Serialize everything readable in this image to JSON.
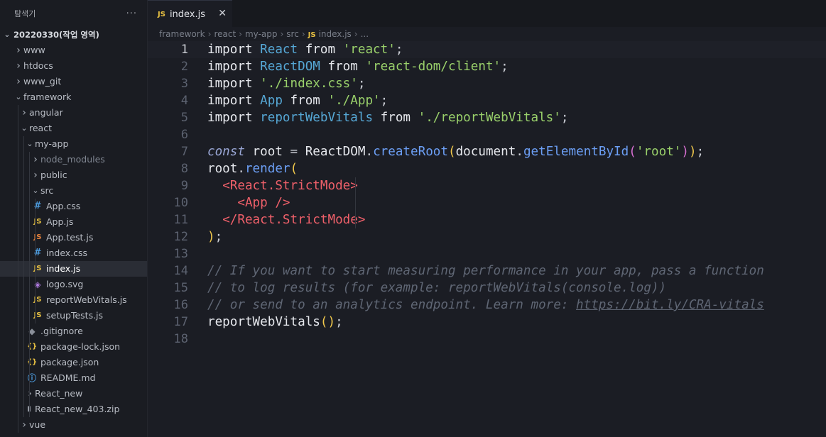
{
  "explorer": {
    "title": "탐색기",
    "more_icon": "more-icon",
    "items": [
      {
        "label": "20220330(작업 영역)",
        "depth": 0,
        "chevron": "down",
        "icon": "",
        "root": true
      },
      {
        "label": "www",
        "depth": 1,
        "chevron": "right",
        "icon": ""
      },
      {
        "label": "htdocs",
        "depth": 1,
        "chevron": "right",
        "icon": ""
      },
      {
        "label": "www_git",
        "depth": 1,
        "chevron": "right",
        "icon": ""
      },
      {
        "label": "framework",
        "depth": 1,
        "chevron": "down",
        "icon": ""
      },
      {
        "label": "angular",
        "depth": 2,
        "chevron": "right",
        "icon": ""
      },
      {
        "label": "react",
        "depth": 2,
        "chevron": "down",
        "icon": ""
      },
      {
        "label": "my-app",
        "depth": 3,
        "chevron": "down",
        "icon": ""
      },
      {
        "label": "node_modules",
        "depth": 4,
        "chevron": "right",
        "icon": "",
        "dim": true
      },
      {
        "label": "public",
        "depth": 4,
        "chevron": "right",
        "icon": ""
      },
      {
        "label": "src",
        "depth": 4,
        "chevron": "down",
        "icon": ""
      },
      {
        "label": "App.css",
        "depth": 5,
        "chevron": "",
        "icon": "css"
      },
      {
        "label": "App.js",
        "depth": 5,
        "chevron": "",
        "icon": "js"
      },
      {
        "label": "App.test.js",
        "depth": 5,
        "chevron": "",
        "icon": "test"
      },
      {
        "label": "index.css",
        "depth": 5,
        "chevron": "",
        "icon": "css"
      },
      {
        "label": "index.js",
        "depth": 5,
        "chevron": "",
        "icon": "js",
        "selected": true
      },
      {
        "label": "logo.svg",
        "depth": 5,
        "chevron": "",
        "icon": "svg"
      },
      {
        "label": "reportWebVitals.js",
        "depth": 5,
        "chevron": "",
        "icon": "js"
      },
      {
        "label": "setupTests.js",
        "depth": 5,
        "chevron": "",
        "icon": "js"
      },
      {
        "label": ".gitignore",
        "depth": 4,
        "chevron": "",
        "icon": "git"
      },
      {
        "label": "package-lock.json",
        "depth": 4,
        "chevron": "",
        "icon": "json"
      },
      {
        "label": "package.json",
        "depth": 4,
        "chevron": "",
        "icon": "json"
      },
      {
        "label": "README.md",
        "depth": 4,
        "chevron": "",
        "icon": "info"
      },
      {
        "label": "React_new",
        "depth": 3,
        "chevron": "right",
        "icon": ""
      },
      {
        "label": "React_new_403.zip",
        "depth": 3,
        "chevron": "",
        "icon": "zip"
      },
      {
        "label": "vue",
        "depth": 2,
        "chevron": "right",
        "icon": ""
      }
    ]
  },
  "icons": {
    "css": {
      "glyph": "#",
      "color": "#4d9de0"
    },
    "js": {
      "glyph": "JS",
      "color": "#e8c142"
    },
    "test": {
      "glyph": "JS",
      "color": "#e8823b"
    },
    "svg": {
      "glyph": "◈",
      "color": "#b07be0"
    },
    "git": {
      "glyph": "◆",
      "color": "#8a8f99"
    },
    "json": {
      "glyph": "{}",
      "color": "#e8c142"
    },
    "info": {
      "glyph": "ⓘ",
      "color": "#4d9de0"
    },
    "zip": {
      "glyph": "▮",
      "color": "#9aa0aa"
    }
  },
  "tab": {
    "badge": "JS",
    "label": "index.js",
    "close": "✕"
  },
  "breadcrumb": {
    "items": [
      "framework",
      "react",
      "my-app",
      "src",
      "index.js",
      "..."
    ],
    "file_badge": "JS"
  },
  "editor": {
    "current_line": 1,
    "lines": [
      [
        [
          "kw",
          "import "
        ],
        [
          "id",
          "React"
        ],
        [
          "kw",
          " from "
        ],
        [
          "str",
          "'react'"
        ],
        [
          "p",
          ";"
        ]
      ],
      [
        [
          "kw",
          "import "
        ],
        [
          "id",
          "ReactDOM"
        ],
        [
          "kw",
          " from "
        ],
        [
          "str",
          "'react-dom/client'"
        ],
        [
          "p",
          ";"
        ]
      ],
      [
        [
          "kw",
          "import "
        ],
        [
          "str",
          "'./index.css'"
        ],
        [
          "p",
          ";"
        ]
      ],
      [
        [
          "kw",
          "import "
        ],
        [
          "id",
          "App"
        ],
        [
          "kw",
          " from "
        ],
        [
          "str",
          "'./App'"
        ],
        [
          "p",
          ";"
        ]
      ],
      [
        [
          "kw",
          "import "
        ],
        [
          "id",
          "reportWebVitals"
        ],
        [
          "kw",
          " from "
        ],
        [
          "str",
          "'./reportWebVitals'"
        ],
        [
          "p",
          ";"
        ]
      ],
      [],
      [
        [
          "it",
          "const"
        ],
        [
          "var",
          " root "
        ],
        [
          "p",
          "= "
        ],
        [
          "var",
          "ReactDOM"
        ],
        [
          "p",
          "."
        ],
        [
          "fn",
          "createRoot"
        ],
        [
          "br",
          "("
        ],
        [
          "var",
          "document"
        ],
        [
          "p",
          "."
        ],
        [
          "fn",
          "getElementById"
        ],
        [
          "br2",
          "("
        ],
        [
          "str",
          "'root'"
        ],
        [
          "br2",
          ")"
        ],
        [
          "br",
          ")"
        ],
        [
          "p",
          ";"
        ]
      ],
      [
        [
          "var",
          "root"
        ],
        [
          "p",
          "."
        ],
        [
          "fn",
          "render"
        ],
        [
          "br",
          "("
        ]
      ],
      [
        [
          "p",
          "  "
        ],
        [
          "tag",
          "<React.StrictMode>"
        ]
      ],
      [
        [
          "p",
          "    "
        ],
        [
          "tag",
          "<App />"
        ]
      ],
      [
        [
          "p",
          "  "
        ],
        [
          "tag",
          "</React.StrictMode>"
        ]
      ],
      [
        [
          "br",
          ")"
        ],
        [
          "p",
          ";"
        ]
      ],
      [],
      [
        [
          "cm",
          "// If you want to start measuring performance in your app, pass a function"
        ]
      ],
      [
        [
          "cm",
          "// to log results (for example: reportWebVitals(console.log))"
        ]
      ],
      [
        [
          "cm",
          "// or send to an analytics endpoint. Learn more: "
        ],
        [
          "link",
          "https://bit.ly/CRA-vitals"
        ]
      ],
      [
        [
          "bare",
          "reportWebVitals"
        ],
        [
          "br",
          "()"
        ],
        [
          "p",
          ";"
        ]
      ],
      []
    ]
  }
}
